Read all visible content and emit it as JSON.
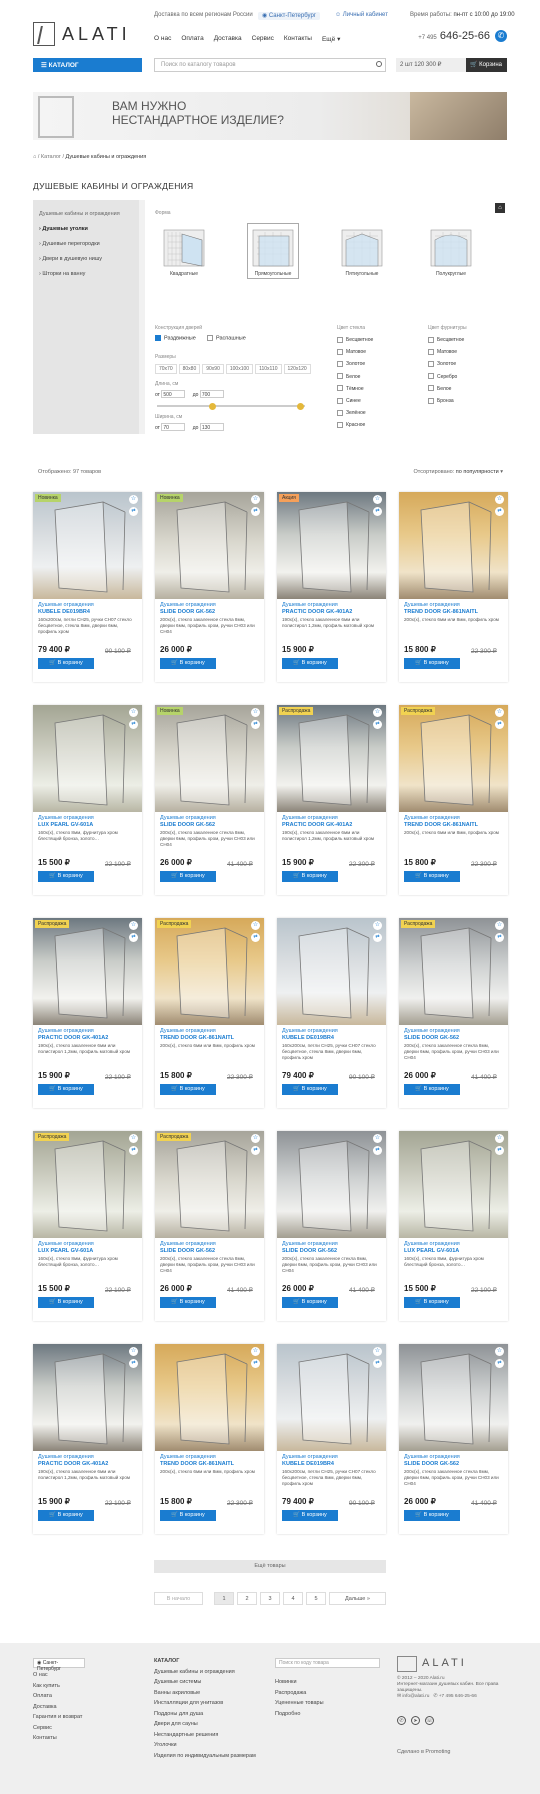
{
  "header": {
    "brand": "ALATI",
    "delivery": "Доставка по всем регионам России",
    "city": "Санкт-Петербург",
    "account": "Личный кабинет",
    "hours_label": "Время работы:",
    "hours": "пн-пт с 10:00 до 19:00",
    "nav": [
      "О нас",
      "Оплата",
      "Доставка",
      "Сервис",
      "Контакты",
      "Ещё"
    ],
    "phone_code": "+7 495",
    "phone": "646-25-66",
    "catalog_label": "КАТАЛОГ",
    "search_placeholder": "Поиск по каталогу товаров",
    "cart_sum": "2 шт 120 300 ₽",
    "cart_label": "Корзина"
  },
  "banner": {
    "line1": "ВАМ НУЖНО",
    "line2": "НЕСТАНДАРТНОЕ ИЗДЕЛИЕ?"
  },
  "breadcrumbs": {
    "home": "⌂",
    "sep": "/",
    "catalog": "Каталог",
    "current": "Душевые кабины и ограждения"
  },
  "page_title": "ДУШЕВЫЕ КАБИНЫ И ОГРАЖДЕНИЯ",
  "sidebar": {
    "title": "Душевые кабины и ограждения",
    "items": [
      "Душевые уголки",
      "Душевые перегородки",
      "Двери в душевую нишу",
      "Шторки на ванну"
    ]
  },
  "filter": {
    "form_label": "Форма",
    "shapes": [
      "Квадратные",
      "Прямоугольные",
      "Пятиугольные",
      "Полукруглые"
    ],
    "door_label": "Конструкция дверей",
    "doors": [
      "Раздвижные",
      "Распашные"
    ],
    "size_label": "Размеры",
    "sizes": [
      "70х70",
      "80х80",
      "90х90",
      "100х100",
      "110х110",
      "120х120"
    ],
    "length_label": "Длина, см",
    "len_from_label": "от",
    "len_from": "500",
    "len_to_label": "до",
    "len_to": "700",
    "height_label": "Ширина, см",
    "h_from_label": "от",
    "h_from": "70",
    "h_to_label": "до",
    "h_to": "130",
    "glass_label": "Цвет стекла",
    "glass": [
      "Бесцветное",
      "Матовое",
      "Золотое",
      "Белое",
      "Тёмное",
      "Синее",
      "Зелёное",
      "Красное"
    ],
    "fitting_label": "Цвет фурнитуры",
    "fittings": [
      "Бесцветное",
      "Матовое",
      "Золотое",
      "Серебро",
      "Белое",
      "Бронза"
    ]
  },
  "listing": {
    "shown": "Отображено: 97 товаров",
    "sort_label": "Отсортировано:",
    "sort_value": "по популярности"
  },
  "buy_label": "В корзину",
  "products": [
    {
      "badge": "Новинка",
      "cat": "Душевые ограждения",
      "name": "KUBELE DE019BR4",
      "desc": "160х200см, петли CH25, ручки CH07 стекло бесцветное, стекла 8мм, дверки 6мм, профиль хром",
      "price": "79 400 ₽",
      "old": "90 100 ₽"
    },
    {
      "badge": "Новинка",
      "cat": "Душевые ограждения",
      "name": "SLIDE DOOR GK-562",
      "desc": "200х(x), стекло закаленное стекла 8мм, дверки 6мм, профиль хром, ручки CH03 или CH04",
      "price": "26 000 ₽",
      "old": ""
    },
    {
      "badge": "Акция",
      "cat": "Душевые ограждения",
      "name": "PRACTIC DOOR GK-401A2",
      "desc": "190х(x), стекло закаленное 6мм или полистирол 1,2мм, профиль матовый хром",
      "price": "15 900 ₽",
      "old": ""
    },
    {
      "badge": "",
      "cat": "Душевые ограждения",
      "name": "TREND DOOR GK-861NAITL",
      "desc": "200х(x), стекло 6мм или 8мм, профиль хром",
      "price": "15 800 ₽",
      "old": "22 300 ₽"
    },
    {
      "badge": "",
      "cat": "Душевые ограждения",
      "name": "LUX PEARL GV-601A",
      "desc": "160х(x), стекло 8мм, фурнитура хром блестящий бронза, золото…",
      "price": "15 500 ₽",
      "old": "22 100 ₽"
    },
    {
      "badge": "Новинка",
      "cat": "Душевые ограждения",
      "name": "SLIDE DOOR GK-562",
      "desc": "200х(x), стекло закаленное стекла 8мм, дверки 6мм, профиль хром, ручки CH03 или CH04",
      "price": "26 000 ₽",
      "old": "41 400 ₽"
    },
    {
      "badge": "Распродажа",
      "cat": "Душевые ограждения",
      "name": "PRACTIC DOOR GK-401A2",
      "desc": "190х(x), стекло закаленное 6мм или полистирол 1,2мм, профиль матовый хром",
      "price": "15 900 ₽",
      "old": "22 300 ₽"
    },
    {
      "badge": "Распродажа",
      "cat": "Душевые ограждения",
      "name": "TREND DOOR GK-861NAITL",
      "desc": "200х(x), стекло 6мм или 8мм, профиль хром",
      "price": "15 800 ₽",
      "old": "22 300 ₽"
    },
    {
      "badge": "Распродажа",
      "cat": "Душевые ограждения",
      "name": "PRACTIC DOOR GK-401A2",
      "desc": "190х(x), стекло закаленное 6мм или полистирол 1,2мм, профиль матовый хром",
      "price": "15 900 ₽",
      "old": "22 100 ₽"
    },
    {
      "badge": "Распродажа",
      "cat": "Душевые ограждения",
      "name": "TREND DOOR GK-861NAITL",
      "desc": "200х(x), стекло 6мм или 8мм, профиль хром",
      "price": "15 800 ₽",
      "old": "22 300 ₽"
    },
    {
      "badge": "",
      "cat": "Душевые ограждения",
      "name": "KUBELE DE019BR4",
      "desc": "160х200см, петли CH25, ручки CH07 стекло бесцветное, стекла 8мм, дверки 6мм, профиль хром",
      "price": "79 400 ₽",
      "old": "90 100 ₽"
    },
    {
      "badge": "Распродажа",
      "cat": "Душевые ограждения",
      "name": "SLIDE DOOR GK-562",
      "desc": "200х(x), стекло закаленное стекла 8мм, дверки 6мм, профиль хром, ручки CH03 или CH04",
      "price": "26 000 ₽",
      "old": "41 400 ₽"
    },
    {
      "badge": "Распродажа",
      "cat": "Душевые ограждения",
      "name": "LUX PEARL GV-601A",
      "desc": "160х(x), стекло 8мм, фурнитура хром блестящий бронза, золото…",
      "price": "15 500 ₽",
      "old": "22 100 ₽"
    },
    {
      "badge": "Распродажа",
      "cat": "Душевые ограждения",
      "name": "SLIDE DOOR GK-562",
      "desc": "200х(x), стекло закаленное стекла 8мм, дверки 6мм, профиль хром, ручки CH03 или CH04",
      "price": "26 000 ₽",
      "old": "41 400 ₽"
    },
    {
      "badge": "",
      "cat": "Душевые ограждения",
      "name": "SLIDE DOOR GK-562",
      "desc": "200х(x), стекло закаленное стекла 8мм, дверки 6мм, профиль хром, ручки CH03 или CH04",
      "price": "26 000 ₽",
      "old": "41 400 ₽"
    },
    {
      "badge": "",
      "cat": "Душевые ограждения",
      "name": "LUX PEARL GV-601A",
      "desc": "160х(x), стекло 8мм, фурнитура хром блестящий бронза, золото…",
      "price": "15 500 ₽",
      "old": "22 100 ₽"
    },
    {
      "badge": "",
      "cat": "Душевые ограждения",
      "name": "PRACTIC DOOR GK-401A2",
      "desc": "190х(x), стекло закаленное 6мм или полистирол 1,2мм, профиль матовый хром",
      "price": "15 900 ₽",
      "old": "22 100 ₽"
    },
    {
      "badge": "",
      "cat": "Душевые ограждения",
      "name": "TREND DOOR GK-861NAITL",
      "desc": "200х(x), стекло 6мм или 8мм, профиль хром",
      "price": "15 800 ₽",
      "old": "22 300 ₽"
    },
    {
      "badge": "",
      "cat": "Душевые ограждения",
      "name": "KUBELE DE019BR4",
      "desc": "160х200см, петли CH25, ручки CH07 стекло бесцветное, стекла 8мм, дверки 6мм, профиль хром",
      "price": "79 400 ₽",
      "old": "90 100 ₽"
    },
    {
      "badge": "",
      "cat": "Душевые ограждения",
      "name": "SLIDE DOOR GK-562",
      "desc": "200х(x), стекло закаленное стекла 8мм, дверки 6мм, профиль хром, ручки CH03 или CH04",
      "price": "26 000 ₽",
      "old": "41 400 ₽"
    }
  ],
  "load_more": "Ещё товары",
  "pagination": {
    "prev": "В начало",
    "pages": [
      "1",
      "2",
      "3",
      "4",
      "5"
    ],
    "next": "Дальше »"
  },
  "footer": {
    "city": "Санкт-Петербург",
    "col1": [
      "О нас",
      "Как купить",
      "Оплата",
      "Доставка",
      "Гарантия и возврат",
      "Сервис",
      "Контакты"
    ],
    "catalog_title": "КАТАЛОГ",
    "col2": [
      "Душевые кабины и ограждения",
      "Душевые системы",
      "Ванны акриловые",
      "Инсталляции для унитазов",
      "Поддоны для душа",
      "Двери для сауны",
      "Нестандартные решения",
      "Уголочки",
      "Изделия по индивидуальным размерам"
    ],
    "search_placeholder": "Поиск по коду товара",
    "col3": [
      "Новинки",
      "Распродажа",
      "Уцененные товары",
      "Подробно"
    ],
    "copyright": "© 2012 – 2020 Alati.ru",
    "about": "Интернет-магазин душевых кабин. Все права защищены.",
    "email": "info@alati.ru",
    "phone": "+7 495 646-25-66",
    "made": "Сделано в Promoting"
  },
  "colors": {
    "accent": "#1a7cd0",
    "dark": "#333333",
    "badge_new": "#b6d36a",
    "badge_sale": "#f5a05a",
    "badge_dist": "#f1d251"
  }
}
